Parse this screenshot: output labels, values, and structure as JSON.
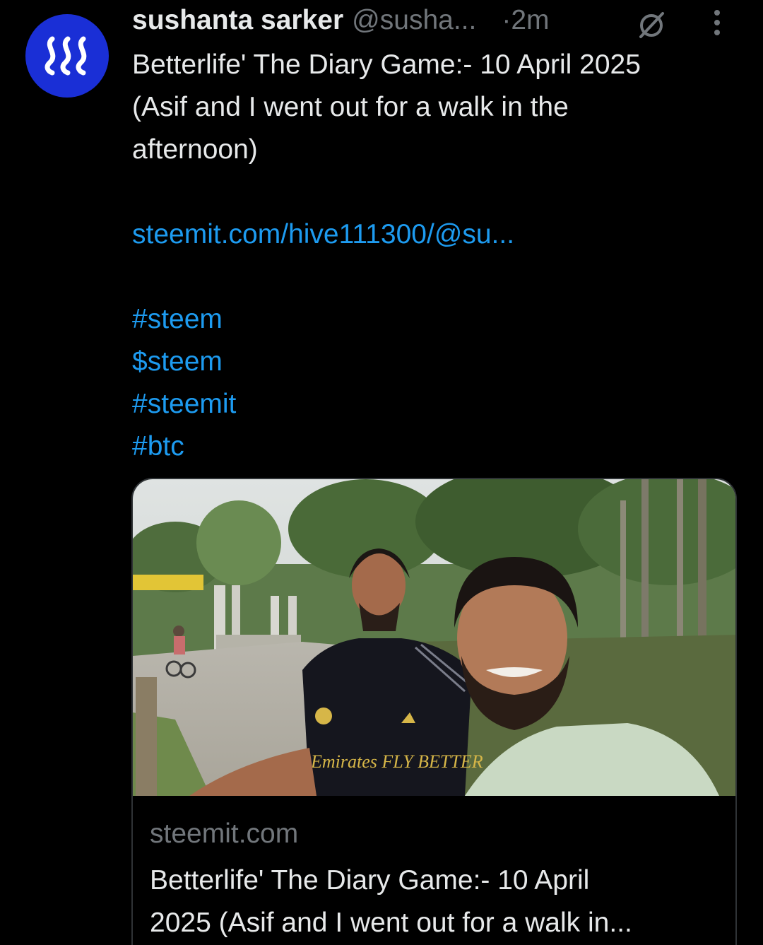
{
  "tweet": {
    "author_name": "sushanta sarker",
    "author_handle": "@susha...",
    "time": "·2m",
    "text_lines": [
      "Betterlife' The Diary Game:- 10 April 2025",
      "(Asif and I went out for a walk in the",
      "afternoon)"
    ],
    "link": "steemit.com/hive111300/@su...",
    "tags": [
      "#steem",
      "$steem",
      "#steemit",
      "#btc"
    ]
  },
  "card": {
    "domain": "steemit.com",
    "title_lines": [
      "Betterlife' The Diary Game:- 10 April",
      "2025 (Asif and I went out for a walk in..."
    ],
    "jersey_text": "Emirates FLY BETTER"
  },
  "icons": {
    "avatar": "steem-logo-icon",
    "grok": "grok-icon",
    "more": "more-vertical-icon"
  },
  "colors": {
    "background": "#000000",
    "text": "#e7e9ea",
    "secondary": "#71767b",
    "link": "#1d9bf0",
    "avatar": "#1a2fd6"
  }
}
